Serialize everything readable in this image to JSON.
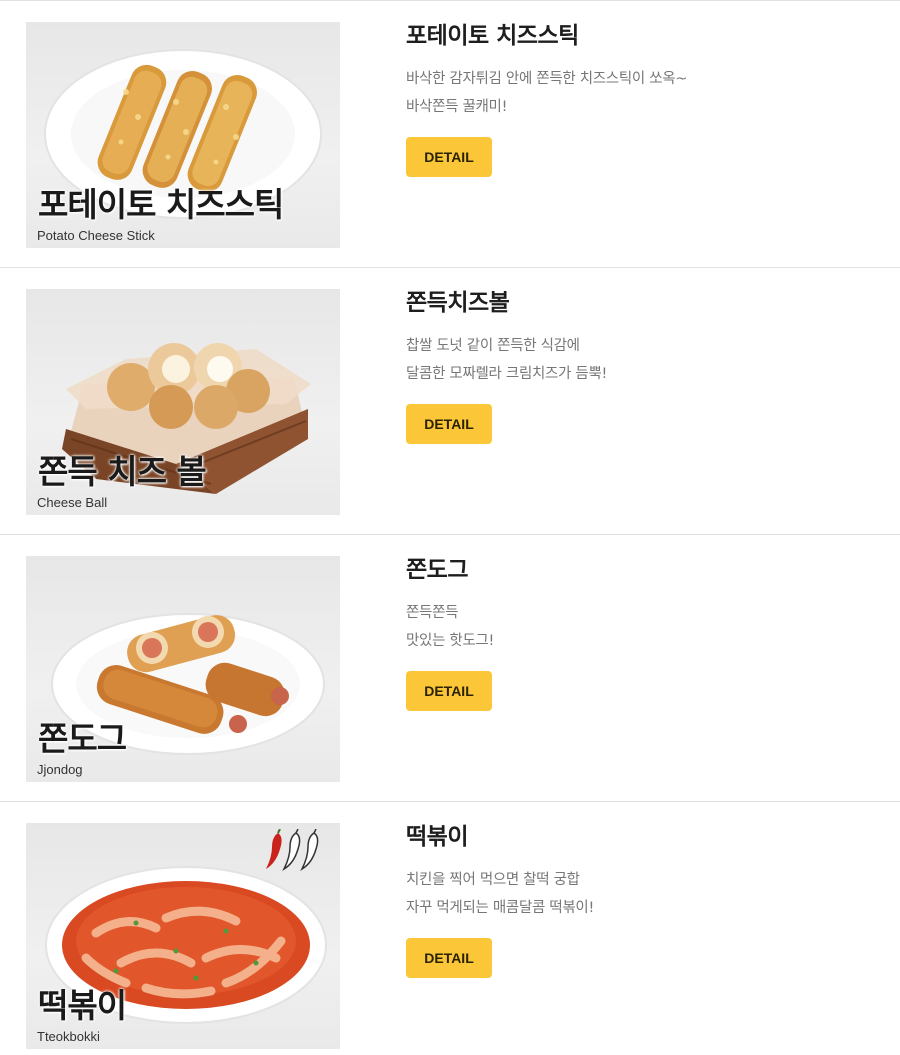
{
  "menu": {
    "items": [
      {
        "image_title": "포테이토 치즈스틱",
        "image_subtitle": "Potato Cheese Stick",
        "title": "포테이토 치즈스틱",
        "desc_lines": [
          "바삭한 감자튀김 안에 쫀득한 치즈스틱이 쏘옥~",
          "바삭쫀득 꿀캐미!"
        ],
        "button_label": "DETAIL"
      },
      {
        "image_title": "쫀득 치즈 볼",
        "image_subtitle": "Cheese Ball",
        "title": "쫀득치즈볼",
        "desc_lines": [
          "찹쌀 도넛 같이 쫀득한 식감에",
          "달콤한 모짜렐라 크림치즈가 듬뿍!"
        ],
        "button_label": "DETAIL"
      },
      {
        "image_title": "쫀도그",
        "image_subtitle": "Jjondog",
        "title": "쫀도그",
        "desc_lines": [
          "쫀득쫀득",
          "맛있는 핫도그!"
        ],
        "button_label": "DETAIL"
      },
      {
        "image_title": "떡볶이",
        "image_subtitle": "Tteokbokki",
        "title": "떡볶이",
        "desc_lines": [
          "치킨을 찍어 먹으면 찰떡 궁합",
          "자꾸 먹게되는 매콤달콤 떡볶이!"
        ],
        "button_label": "DETAIL",
        "spice_icon": "chili-pepper-icon"
      }
    ]
  },
  "colors": {
    "button": "#fbc739",
    "title": "#1e1e1e",
    "description": "#777777",
    "divider": "#e2e2e2"
  }
}
